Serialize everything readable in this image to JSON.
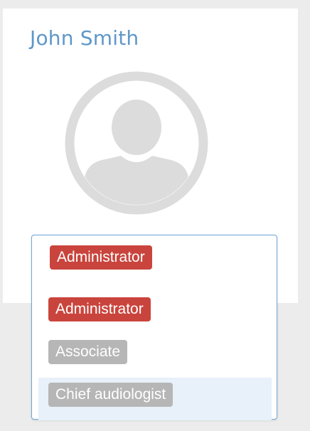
{
  "profile": {
    "name": "John Smith",
    "avatar_icon": "user-avatar-icon"
  },
  "role_select": {
    "selected": "Administrator",
    "options": [
      {
        "label": "Administrator",
        "color": "#c9443c",
        "highlighted": false
      },
      {
        "label": "Associate",
        "color": "#b6b6b6",
        "highlighted": false
      },
      {
        "label": "Chief audiologist",
        "color": "#b6b6b6",
        "highlighted": true
      }
    ]
  },
  "colors": {
    "name_text": "#5f97c8",
    "badge_red": "#c9443c",
    "badge_grey": "#b6b6b6",
    "select_border": "#6fa6d9",
    "highlight_bg": "#e8f1fa"
  }
}
